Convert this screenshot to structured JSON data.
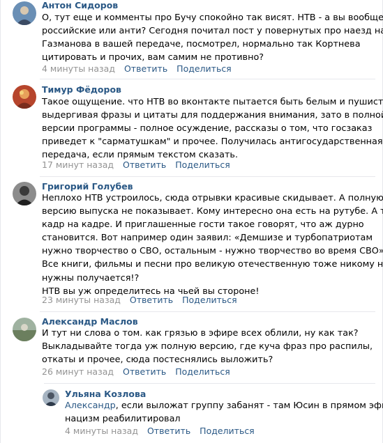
{
  "comments": [
    {
      "author": "Антон Сидоров",
      "lines": [
        "О, тут еще и комменты про Бучу спокойно так висят. НТВ - а вы вообще",
        "российские или анти? Сегодня почитал пост у повернутых про наезд на",
        "Газманова в вашей передаче, посмотрел, нормально так Кортнева",
        "цитировать и прочих, вам самим не противно?"
      ],
      "time": "4 минуты назад",
      "reply_label": "Ответить",
      "share_label": "Поделиться"
    },
    {
      "author": "Тимур Фёдоров",
      "lines": [
        "Такое ощущение. что НТВ во вконтакте пытается быть белым и пушистым,",
        "выдергивая фразы и цитаты для поддержания внимания, зато в полной",
        "версии программы - полное осуждение, рассказы о том, что госзаказ",
        "приведет к \"сарматушкам\" и прочее. Получилась антигосударственная",
        "передача, если прямым текстом сказать."
      ],
      "time": "17 минут назад",
      "reply_label": "Ответить",
      "share_label": "Поделиться"
    },
    {
      "author": "Григорий Голубев",
      "lines": [
        "Неплохо НТВ устроилось, сюда отрывки красивые скидывает. А полную",
        "версию выпуска не показывает. Кому интересно она есть на рутубе. А там",
        "кадр на кадре. И приглашенные гости такое говорят, что аж дурно",
        "становится. Вот например один заявил: «Демшизе и турбопатриотам",
        "нужно творчество о СВО, остальным - нужно творчество во время СВО».",
        "Все книги, фильмы и песни про великую отечественную тоже никому не",
        "нужны получается!?",
        "НТВ вы уж определитесь на чьей вы стороне!"
      ],
      "time": "23 минуты назад",
      "reply_label": "Ответить",
      "share_label": "Поделиться"
    },
    {
      "author": "Александр Маслов",
      "lines": [
        "И тут ни слова о том. как грязью в эфире всех облили, ну как так?",
        "Выкладывайте тогда уж полную версию, где куча фраз про распилы,",
        "откаты и прочее, сюда постеснялись выложить?"
      ],
      "time": "26 минут назад",
      "reply_label": "Ответить",
      "share_label": "Поделиться"
    }
  ],
  "reply": {
    "author": "Ульяна Козлова",
    "mention": "Александр",
    "lines": [
      ", если выложат группу забанят - там Юсин в прямом эфире",
      "нацизм реабилитировал"
    ],
    "time": "4 минуты назад",
    "reply_label": "Ответить",
    "share_label": "Поделиться"
  },
  "colors": {
    "link": "#2a5885",
    "meta": "#939393",
    "divider": "#e7e8ec"
  },
  "icons": [
    "avatar-anton",
    "avatar-timur",
    "avatar-grigoriy",
    "avatar-aleksandr",
    "avatar-ulyana"
  ]
}
